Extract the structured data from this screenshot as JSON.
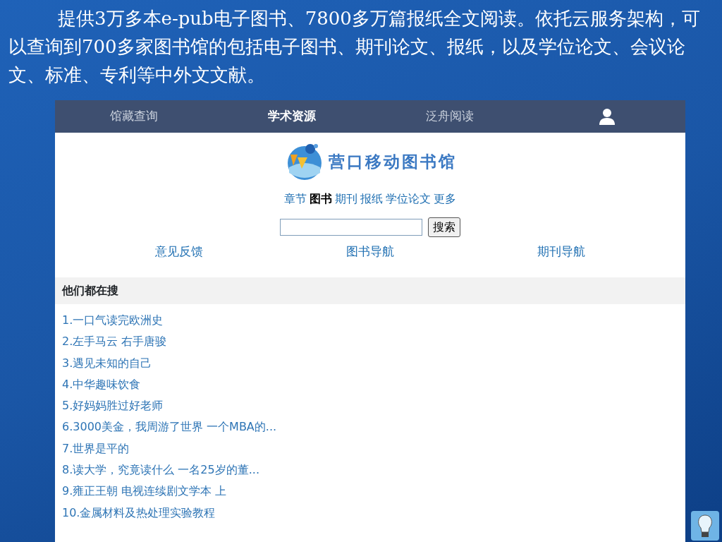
{
  "slide_text": "提供3万多本e-pub电子图书、7800多万篇报纸全文阅读。依托云服务架构，可以查询到700多家图书馆的包括电子图书、期刊论文、报纸，以及学位论文、会议论文、标准、专利等中外文文献。",
  "nav_tabs": [
    {
      "label": "馆藏查询",
      "selected": false
    },
    {
      "label": "学术资源",
      "selected": true
    },
    {
      "label": "泛舟阅读",
      "selected": false
    }
  ],
  "logo_text": "营口移动图书馆",
  "categories": [
    {
      "label": "章节",
      "selected": false
    },
    {
      "label": "图书",
      "selected": true
    },
    {
      "label": "期刊",
      "selected": false
    },
    {
      "label": "报纸",
      "selected": false
    },
    {
      "label": "学位论文",
      "selected": false
    },
    {
      "label": "更多",
      "selected": false
    }
  ],
  "search": {
    "button": "搜索"
  },
  "links": [
    "意见反馈",
    "图书导航",
    "期刊导航"
  ],
  "section_title": "他们都在搜",
  "hot_searches": [
    "1.一口气读完欧洲史",
    "2.左手马云  右手唐骏",
    "3.遇见未知的自己",
    "4.中华趣味饮食",
    "5.好妈妈胜过好老师",
    "6.3000美金，我周游了世界  一个MBA的...",
    "7.世界是平的",
    "8.读大学，究竟读什么  一名25岁的董...",
    "9.雍正王朝  电视连续剧文学本  上",
    "10.金属材料及热处理实验教程"
  ]
}
